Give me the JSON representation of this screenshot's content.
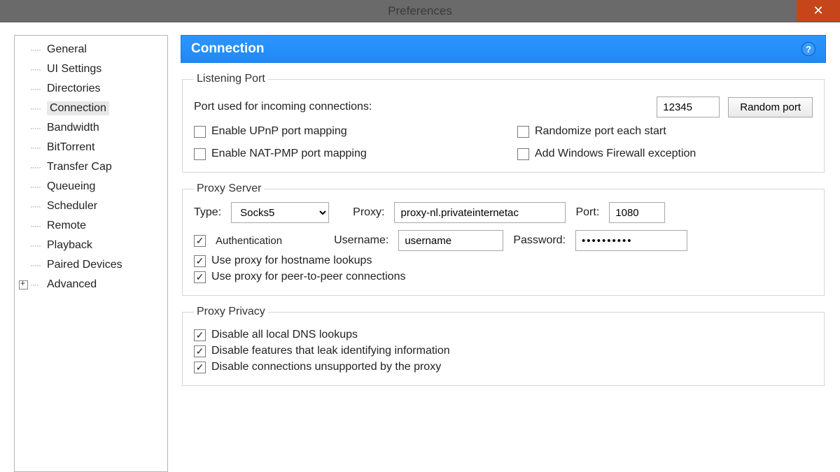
{
  "window": {
    "title": "Preferences",
    "close_glyph": "✕"
  },
  "sidebar": {
    "items": [
      {
        "label": "General"
      },
      {
        "label": "UI Settings"
      },
      {
        "label": "Directories"
      },
      {
        "label": "Connection",
        "selected": true
      },
      {
        "label": "Bandwidth"
      },
      {
        "label": "BitTorrent"
      },
      {
        "label": "Transfer Cap"
      },
      {
        "label": "Queueing"
      },
      {
        "label": "Scheduler"
      },
      {
        "label": "Remote"
      },
      {
        "label": "Playback"
      },
      {
        "label": "Paired Devices"
      },
      {
        "label": "Advanced",
        "expandable": true
      }
    ]
  },
  "header": {
    "title": "Connection",
    "help_glyph": "?"
  },
  "listening_port": {
    "legend": "Listening Port",
    "port_label": "Port used for incoming connections:",
    "port_value": "12345",
    "random_button": "Random port",
    "upnp": {
      "checked": false,
      "label": "Enable UPnP port mapping"
    },
    "natpmp": {
      "checked": false,
      "label": "Enable NAT-PMP port mapping"
    },
    "randomize": {
      "checked": false,
      "label": "Randomize port each start"
    },
    "firewall": {
      "checked": false,
      "label": "Add Windows Firewall exception"
    }
  },
  "proxy_server": {
    "legend": "Proxy Server",
    "type_label": "Type:",
    "type_value": "Socks5",
    "proxy_label": "Proxy:",
    "proxy_value": "proxy-nl.privateinternetac",
    "port_label": "Port:",
    "port_value": "1080",
    "auth": {
      "checked": true,
      "label": "Authentication"
    },
    "username_label": "Username:",
    "username_value": "username",
    "password_label": "Password:",
    "password_value": "••••••••••",
    "hostname_lookups": {
      "checked": true,
      "label": "Use proxy for hostname lookups"
    },
    "p2p": {
      "checked": true,
      "label": "Use proxy for peer-to-peer connections"
    }
  },
  "proxy_privacy": {
    "legend": "Proxy Privacy",
    "dns": {
      "checked": true,
      "label": "Disable all local DNS lookups"
    },
    "leak": {
      "checked": true,
      "label": "Disable features that leak identifying information"
    },
    "unsupported": {
      "checked": true,
      "label": "Disable connections unsupported by the proxy"
    }
  }
}
